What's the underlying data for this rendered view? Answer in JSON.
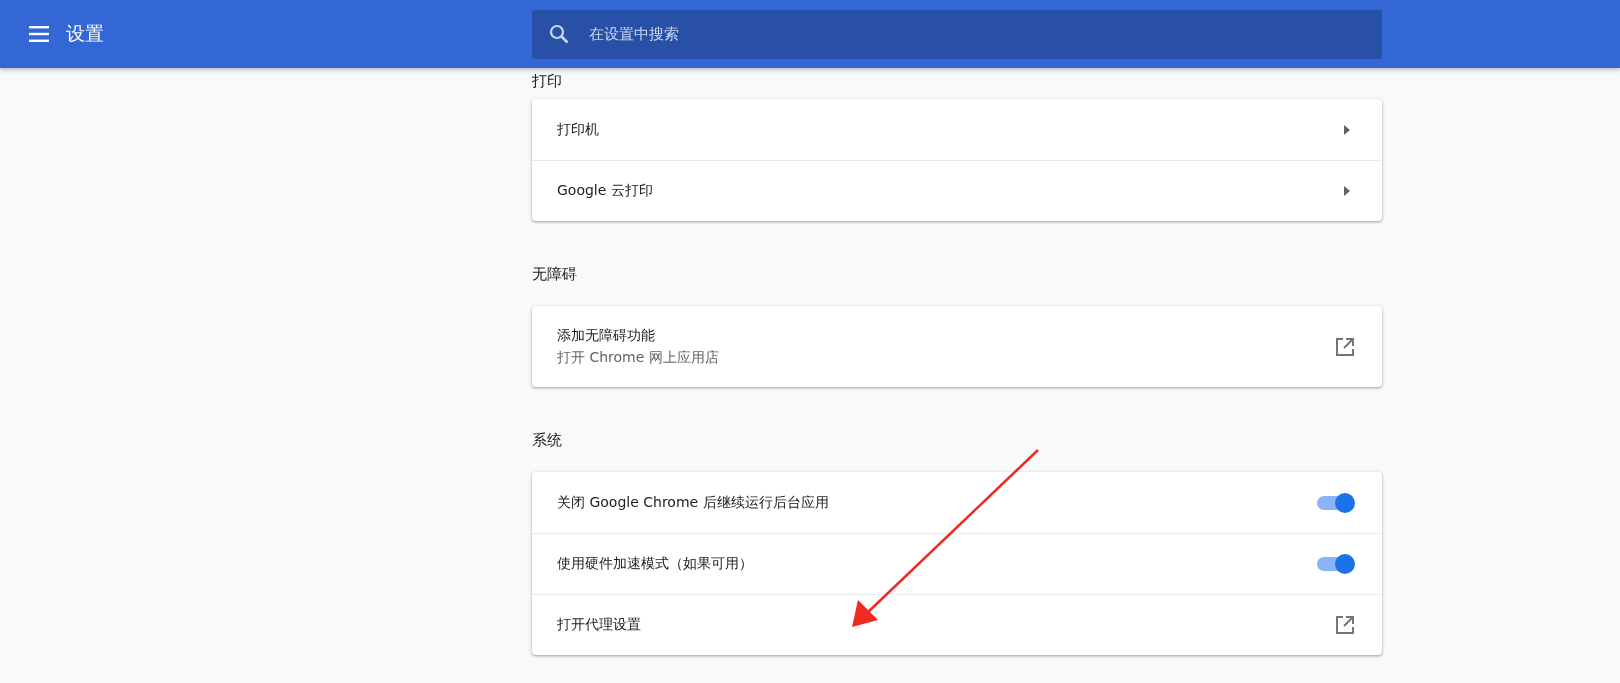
{
  "header": {
    "title": "设置",
    "search": {
      "placeholder": "在设置中搜索"
    }
  },
  "sections": [
    {
      "heading": "打印",
      "items": [
        {
          "kind": "arrow",
          "label": "打印机"
        },
        {
          "kind": "arrow",
          "label": "Google 云打印"
        }
      ]
    },
    {
      "heading": "无障碍",
      "items": [
        {
          "kind": "external",
          "label": "添加无障碍功能",
          "sublabel": "打开 Chrome 网上应用店"
        }
      ]
    },
    {
      "heading": "系统",
      "items": [
        {
          "kind": "toggle",
          "label": "关闭 Google Chrome 后继续运行后台应用",
          "on": true
        },
        {
          "kind": "toggle",
          "label": "使用硬件加速模式（如果可用）",
          "on": true
        },
        {
          "kind": "external",
          "label": "打开代理设置"
        }
      ]
    }
  ],
  "annotation": {
    "kind": "arrow"
  }
}
